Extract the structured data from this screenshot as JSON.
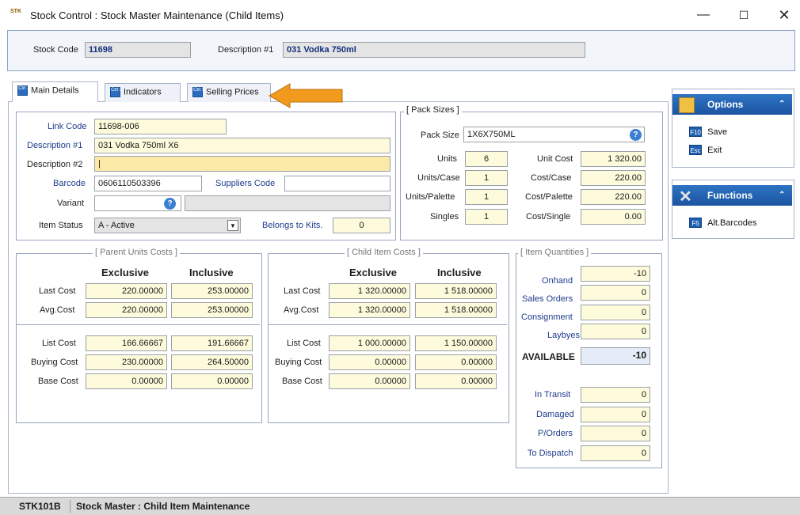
{
  "window": {
    "title": "Stock Control : Stock Master Maintenance (Child Items)",
    "icon_text": "STK",
    "buttons": {
      "minimize": "—",
      "maximize": "☐",
      "close": "✕"
    }
  },
  "header": {
    "stock_code_label": "Stock Code",
    "stock_code": "11698",
    "desc1_label": "Description #1",
    "desc1": "031 Vodka 750ml"
  },
  "tabs": [
    {
      "label": "Main Details",
      "key": "Ctrl 1"
    },
    {
      "label": "Indicators",
      "key": "Ctrl 2"
    },
    {
      "label": "Selling Prices",
      "key": "Ctrl 3"
    }
  ],
  "details": {
    "link_code_label": "Link Code",
    "link_code": "11698-006",
    "desc1_label": "Description #1",
    "desc1": "031 Vodka 750ml X6",
    "desc2_label": "Description #2",
    "desc2": "|",
    "barcode_label": "Barcode",
    "barcode": "0606110503396",
    "suppliers_code_label": "Suppliers Code",
    "suppliers_code": "",
    "variant_label": "Variant",
    "variant": "",
    "variant_desc": "",
    "item_status_label": "Item Status",
    "item_status": "A - Active",
    "belongs_to_kits_label": "Belongs to Kits.",
    "belongs_to_kits": "0"
  },
  "pack_sizes": {
    "title": "[ Pack Sizes ]",
    "pack_size_label": "Pack Size",
    "pack_size": "1X6X750ML",
    "units_label": "Units",
    "units": "6",
    "units_case_label": "Units/Case",
    "units_case": "1",
    "units_palette_label": "Units/Palette",
    "units_palette": "1",
    "singles_label": "Singles",
    "singles": "1",
    "unit_cost_label": "Unit Cost",
    "unit_cost": "1 320.00",
    "cost_case_label": "Cost/Case",
    "cost_case": "220.00",
    "cost_palette_label": "Cost/Palette",
    "cost_palette": "220.00",
    "cost_single_label": "Cost/Single",
    "cost_single": "0.00"
  },
  "parent_costs": {
    "title": "[ Parent Units Costs ]",
    "col_exclusive": "Exclusive",
    "col_inclusive": "Inclusive",
    "rows": [
      {
        "label": "Last Cost",
        "excl": "220.00000",
        "incl": "253.00000"
      },
      {
        "label": "Avg.Cost",
        "excl": "220.00000",
        "incl": "253.00000"
      },
      {
        "label": "List Cost",
        "excl": "166.66667",
        "incl": "191.66667"
      },
      {
        "label": "Buying Cost",
        "excl": "230.00000",
        "incl": "264.50000"
      },
      {
        "label": "Base Cost",
        "excl": "0.00000",
        "incl": "0.00000"
      }
    ]
  },
  "child_costs": {
    "title": "[ Child Item Costs ]",
    "col_exclusive": "Exclusive",
    "col_inclusive": "Inclusive",
    "rows": [
      {
        "label": "Last Cost",
        "excl": "1 320.00000",
        "incl": "1 518.00000"
      },
      {
        "label": "Avg.Cost",
        "excl": "1 320.00000",
        "incl": "1 518.00000"
      },
      {
        "label": "List Cost",
        "excl": "1 000.00000",
        "incl": "1 150.00000"
      },
      {
        "label": "Buying Cost",
        "excl": "0.00000",
        "incl": "0.00000"
      },
      {
        "label": "Base Cost",
        "excl": "0.00000",
        "incl": "0.00000"
      }
    ]
  },
  "quantities": {
    "title": "[ Item Quantities ]",
    "rows": [
      {
        "label": "Onhand",
        "value": "-10"
      },
      {
        "label": "Sales Orders",
        "value": "0"
      },
      {
        "label": "Consignment",
        "value": "0"
      },
      {
        "label": "Laybyes",
        "value": "0"
      }
    ],
    "available_label": "AVAILABLE",
    "available": "-10",
    "rows2": [
      {
        "label": "In Transit",
        "value": "0"
      },
      {
        "label": "Damaged",
        "value": "0"
      },
      {
        "label": "P/Orders",
        "value": "0"
      },
      {
        "label": "To Dispatch",
        "value": "0"
      }
    ]
  },
  "options_panel": {
    "title": "Options",
    "items": [
      {
        "key": "F10",
        "label": "Save"
      },
      {
        "key": "Esc",
        "label": "Exit"
      }
    ]
  },
  "functions_panel": {
    "title": "Functions",
    "items": [
      {
        "key": "F5",
        "label": "Alt.Barcodes"
      }
    ]
  },
  "status": {
    "code": "STK101B",
    "text": "Stock Master : Child Item Maintenance"
  },
  "colors": {
    "field_bg": "#fdfbdc",
    "panel_header": "#1c54a0",
    "arrow": "#f29a1d"
  }
}
